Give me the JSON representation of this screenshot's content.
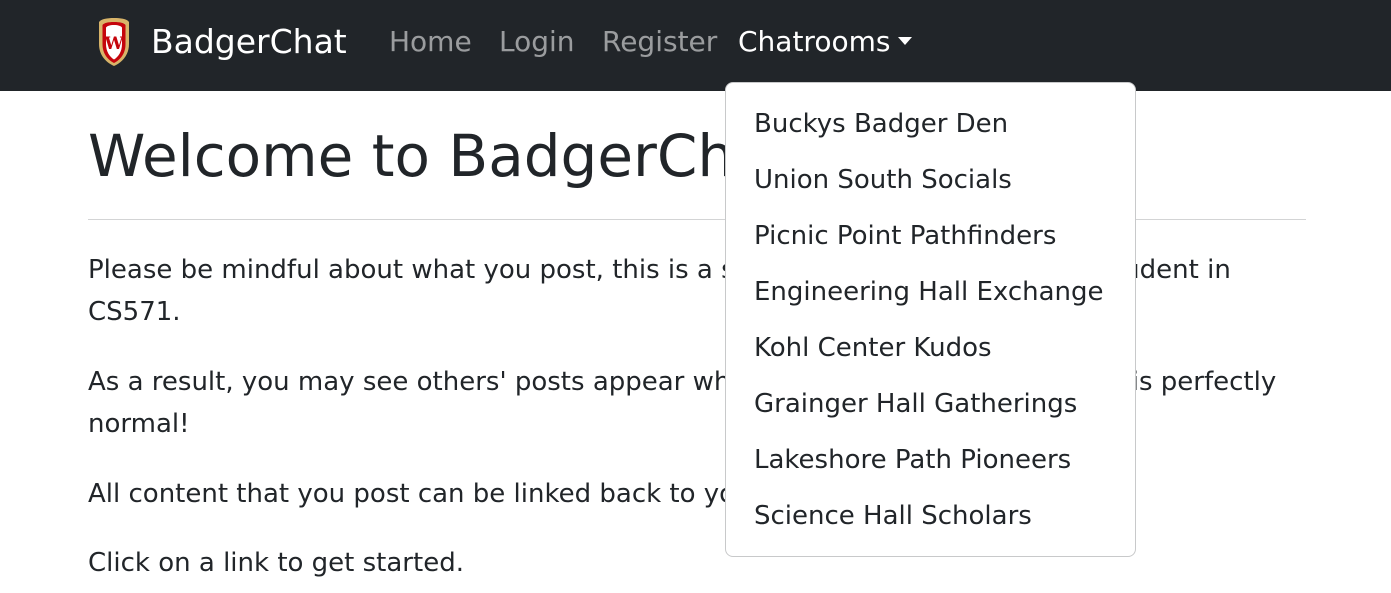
{
  "navbar": {
    "brand": "BadgerChat",
    "logo_letter": "W",
    "links": [
      "Home",
      "Login",
      "Register"
    ],
    "chatrooms_label": "Chatrooms"
  },
  "main": {
    "title": "Welcome to BadgerChat!",
    "paragraphs": [
      "Please be mindful about what you post, this is a shared chat server for every student in CS571.",
      "As a result, you may see others' posts appear while you are using the app. This is perfectly normal!",
      "All content that you post can be linked back to you.",
      "Click on a link to get started."
    ]
  },
  "dropdown": {
    "items": [
      "Buckys Badger Den",
      "Union South Socials",
      "Picnic Point Pathfinders",
      "Engineering Hall Exchange",
      "Kohl Center Kudos",
      "Grainger Hall Gatherings",
      "Lakeshore Path Pioneers",
      "Science Hall Scholars"
    ]
  },
  "colors": {
    "navbar_bg": "#212529",
    "crest_red": "#c5050c",
    "crest_gold": "#d8b469"
  }
}
